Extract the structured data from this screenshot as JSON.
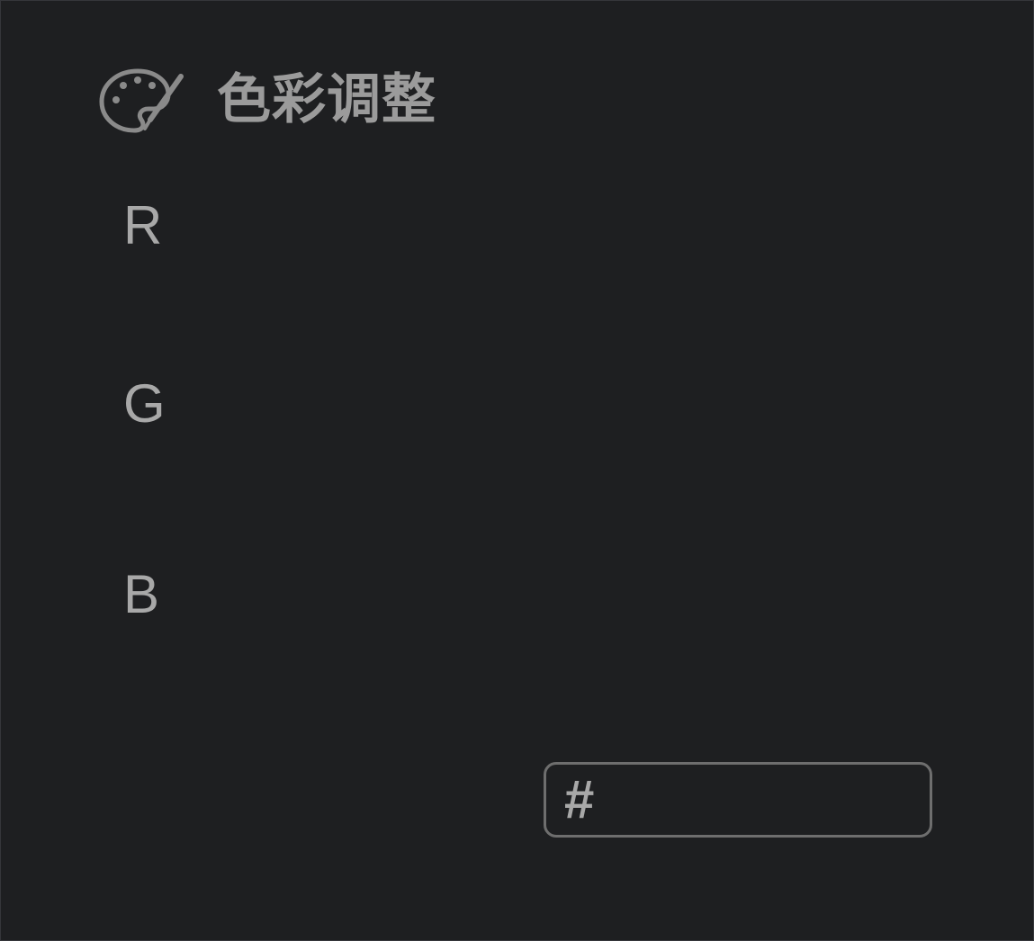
{
  "header": {
    "icon": "palette-icon",
    "title": "色彩调整"
  },
  "channels": [
    {
      "label": "R"
    },
    {
      "label": "G"
    },
    {
      "label": "B"
    }
  ],
  "hex": {
    "prefix": "#",
    "value": ""
  },
  "colors": {
    "background": "#1e1f21",
    "text": "#a8a8a8",
    "icon": "#8c8c8c",
    "input_border": "#6e6e6e"
  }
}
